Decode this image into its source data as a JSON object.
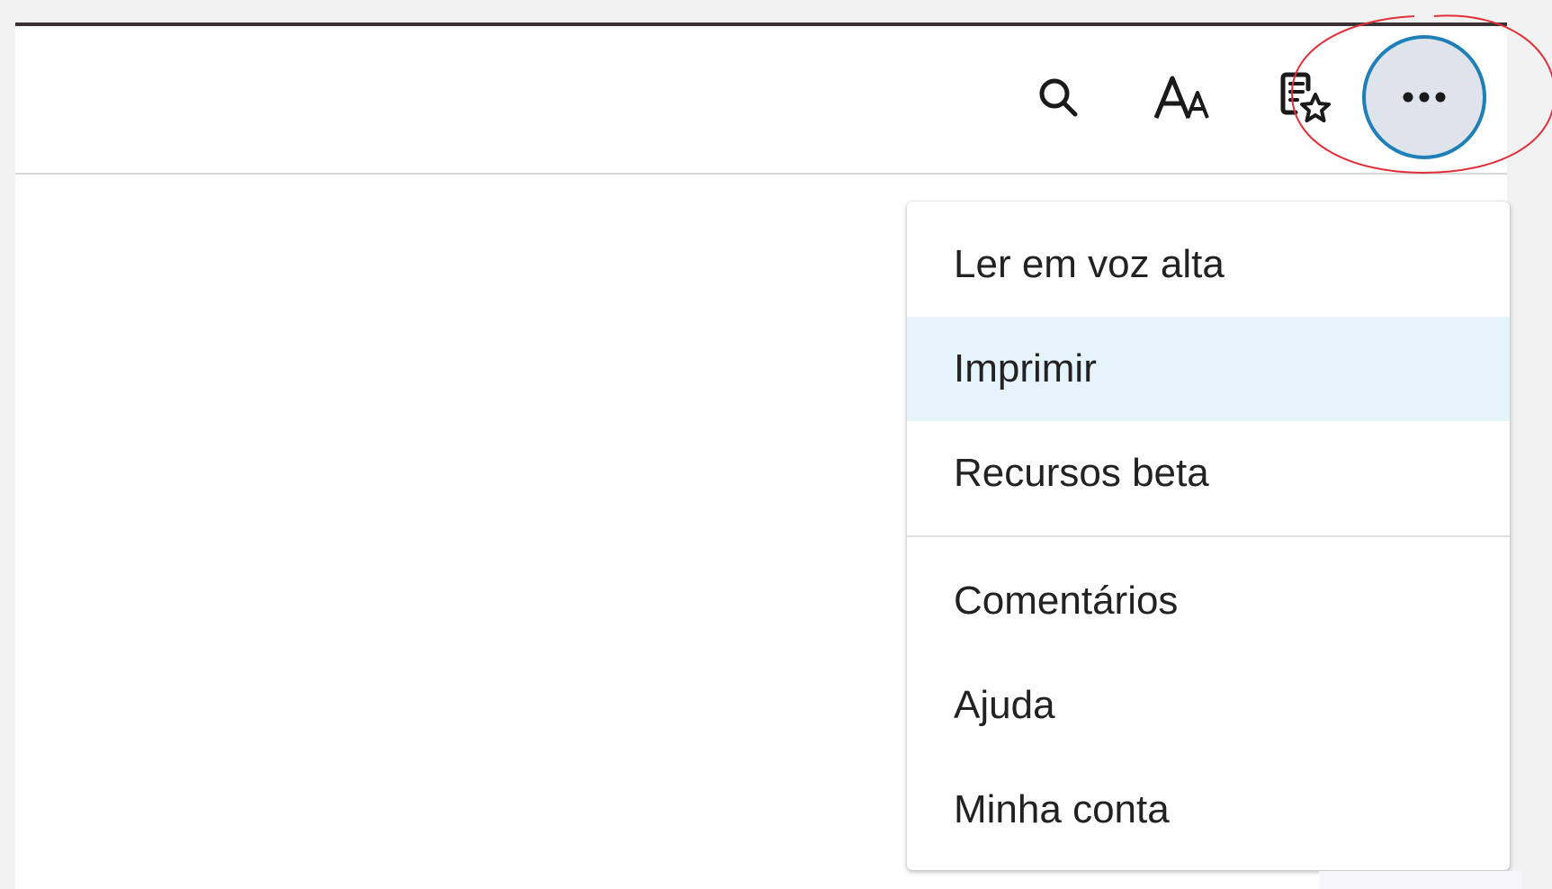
{
  "toolbar": {
    "buttons": [
      {
        "name": "search",
        "icon": "search-icon"
      },
      {
        "name": "text-options",
        "icon": "text-size-icon"
      },
      {
        "name": "immersive-reader",
        "icon": "reader-favorite-icon"
      },
      {
        "name": "more-options",
        "icon": "more-horizontal-icon",
        "glyph": "•••"
      }
    ]
  },
  "dropdown": {
    "items": [
      {
        "label": "Ler em voz alta",
        "highlighted": false
      },
      {
        "label": "Imprimir",
        "highlighted": true
      },
      {
        "label": "Recursos beta",
        "highlighted": false
      },
      {
        "label": "Comentários",
        "highlighted": false
      },
      {
        "label": "Ajuda",
        "highlighted": false
      },
      {
        "label": "Minha conta",
        "highlighted": false
      }
    ]
  },
  "colors": {
    "accent_ring": "#1f7fb8",
    "more_button_bg": "#dfe3ec",
    "highlight_bg": "#e5f3fa",
    "annotation": "#e0303a"
  }
}
